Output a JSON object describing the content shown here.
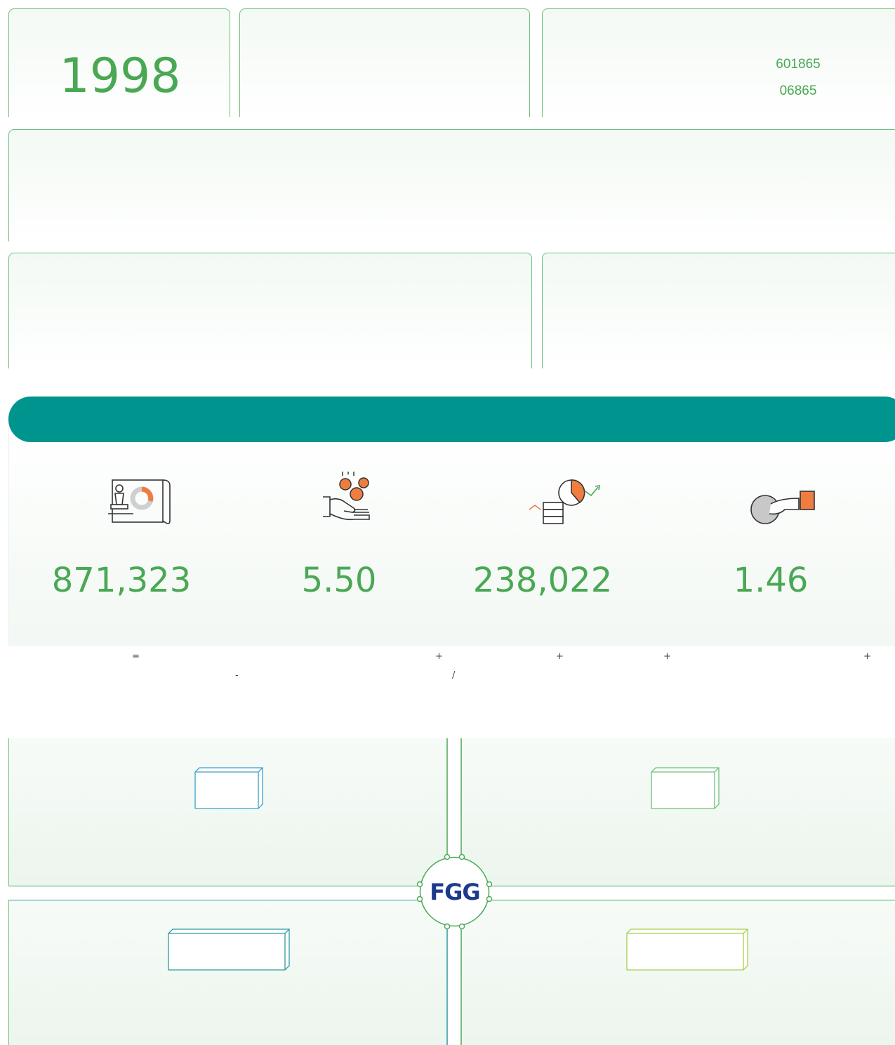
{
  "top_cards": {
    "year": "1998",
    "stock_codes": [
      "601865",
      "06865"
    ]
  },
  "kpis": [
    {
      "value": "871,323",
      "icon": "strategy-chess-chart-icon"
    },
    {
      "value": "5.50",
      "icon": "hand-coins-icon"
    },
    {
      "value": "238,022",
      "icon": "coins-pie-growth-icon"
    },
    {
      "value": "1.46",
      "icon": "hand-ball-icon"
    }
  ],
  "formula": {
    "equals": "=",
    "plus": "+",
    "minus": "-",
    "slash": "/"
  },
  "logo": {
    "text": "FGG"
  },
  "colors": {
    "brand_green": "#4aa854",
    "teal_band": "#00948e",
    "accent_orange": "#ef7d3f",
    "logo_blue": "#1b3a8c"
  }
}
